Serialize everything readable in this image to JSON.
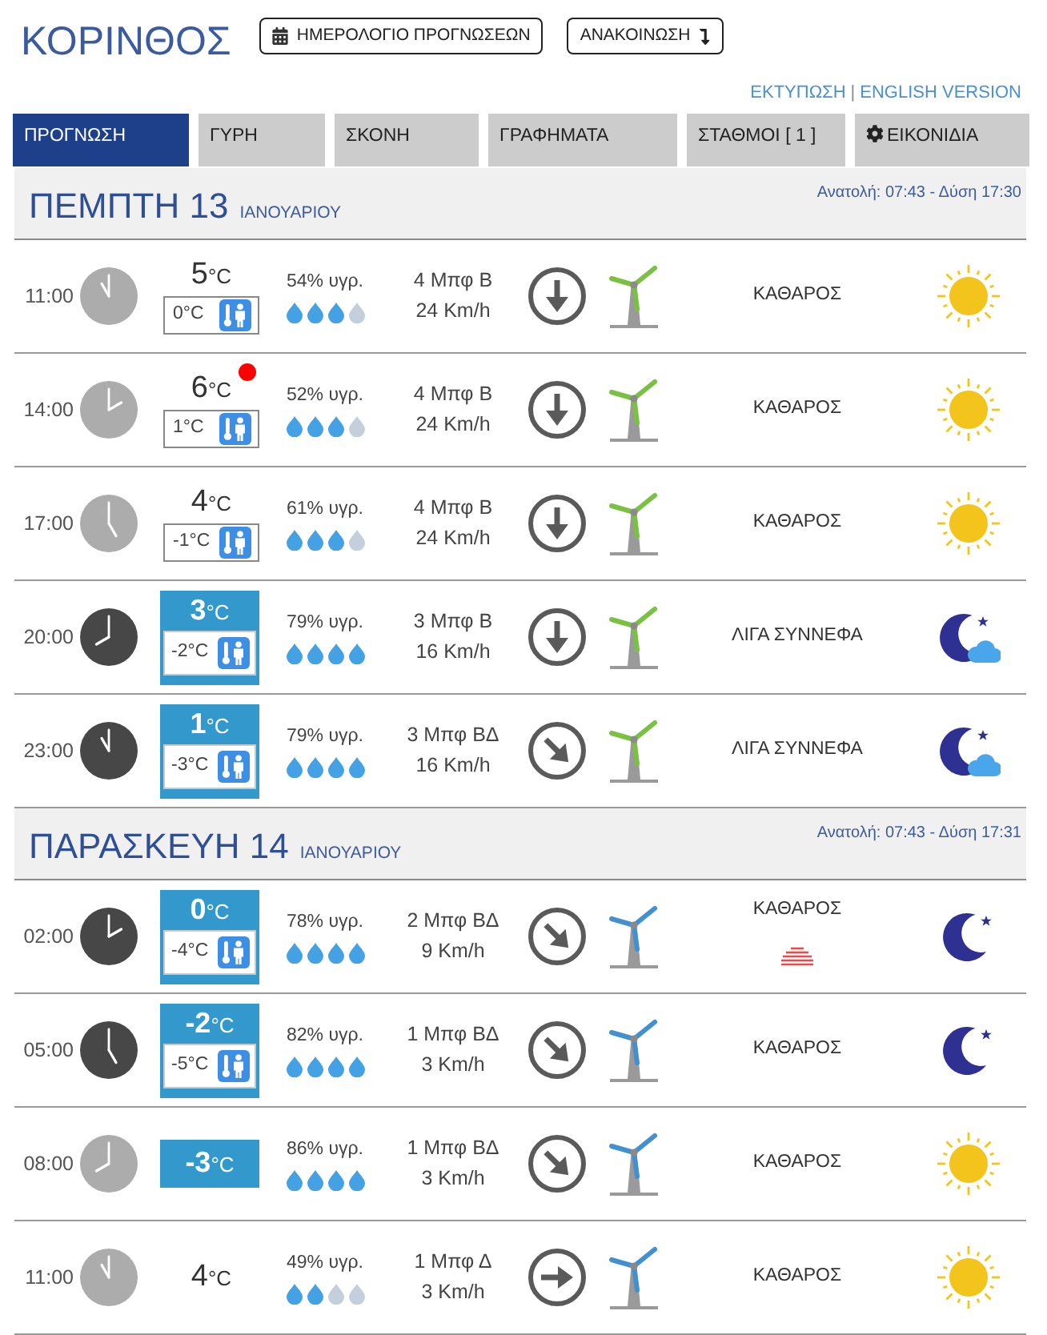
{
  "header": {
    "title": "ΚΟΡΙΝΘΟΣ",
    "buttons": [
      {
        "label": "ΗΜΕΡΟΛΟΓΙΟ ΠΡΟΓΝΩΣΕΩΝ",
        "kind": "calendar"
      },
      {
        "label": "ΑΝΑΚΟΙΝΩΣΗ",
        "kind": "announcement"
      }
    ],
    "links": [
      "ΕΚΤΥΠΩΣΗ",
      "ENGLISH VERSION"
    ],
    "link_separator": "|"
  },
  "tabs": [
    {
      "label": "ΠΡΟΓΝΩΣΗ",
      "selected": true,
      "kind": "plain"
    },
    {
      "label": "ΓΥΡΗ",
      "selected": false,
      "kind": "plain"
    },
    {
      "label": "ΣΚΟΝΗ",
      "selected": false,
      "kind": "plain"
    },
    {
      "label": "ΓΡΑΦΗΜΑΤΑ",
      "selected": false,
      "kind": "plain"
    },
    {
      "label": "ΣΤΑΘΜΟΙ [ 1 ]",
      "selected": false,
      "kind": "plain"
    },
    {
      "label": "ΕΙΚΟΝΙΔΙΑ",
      "selected": false,
      "kind": "settings"
    }
  ],
  "days": [
    {
      "title": "ΠΕΜΠΤΗ 13",
      "month": "ΙΑΝΟΥΑΡΙΟΥ",
      "sun_times": "Ανατολή: 07:43 - Δύση 17:30",
      "rows": [
        {
          "time": "11:00",
          "night": false,
          "temp": {
            "value": "5",
            "unit": "°C",
            "highlighted": false
          },
          "feels_like": "0°C",
          "notice": false,
          "humidity": {
            "label": "54% υγρ.",
            "stars": 3
          },
          "wind": {
            "force": "4 Μπφ Β",
            "speed": "24 Km/h",
            "arrow": {
              "kind": "down"
            }
          },
          "turbine": {
            "color": "#7ac143"
          },
          "condition": "ΚΑΘΑΡΟΣ",
          "haze": false,
          "sky": {
            "kind": "sun"
          }
        },
        {
          "time": "14:00",
          "night": false,
          "temp": {
            "value": "6",
            "unit": "°C",
            "highlighted": false
          },
          "feels_like": "1°C",
          "notice": true,
          "humidity": {
            "label": "52% υγρ.",
            "stars": 3
          },
          "wind": {
            "force": "4 Μπφ Β",
            "speed": "24 Km/h",
            "arrow": {
              "kind": "down"
            }
          },
          "turbine": {
            "color": "#7ac143"
          },
          "condition": "ΚΑΘΑΡΟΣ",
          "haze": false,
          "sky": {
            "kind": "sun"
          }
        },
        {
          "time": "17:00",
          "night": false,
          "temp": {
            "value": "4",
            "unit": "°C",
            "highlighted": false
          },
          "feels_like": "-1°C",
          "notice": false,
          "humidity": {
            "label": "61% υγρ.",
            "stars": 3
          },
          "wind": {
            "force": "4 Μπφ Β",
            "speed": "24 Km/h",
            "arrow": {
              "kind": "down"
            }
          },
          "turbine": {
            "color": "#7ac143"
          },
          "condition": "ΚΑΘΑΡΟΣ",
          "haze": false,
          "sky": {
            "kind": "sun"
          }
        },
        {
          "time": "20:00",
          "night": true,
          "temp": {
            "value": "3",
            "unit": "°C",
            "highlighted": true
          },
          "feels_like": "-2°C",
          "notice": false,
          "humidity": {
            "label": "79% υγρ.",
            "stars": 4
          },
          "wind": {
            "force": "3 Μπφ Β",
            "speed": "16 Km/h",
            "arrow": {
              "kind": "down"
            }
          },
          "turbine": {
            "color": "#7ac143"
          },
          "condition": "ΛΙΓΑ ΣΥΝΝΕΦΑ",
          "haze": false,
          "sky": {
            "kind": "moon-cloud"
          }
        },
        {
          "time": "23:00",
          "night": true,
          "temp": {
            "value": "1",
            "unit": "°C",
            "highlighted": true
          },
          "feels_like": "-3°C",
          "notice": false,
          "humidity": {
            "label": "79% υγρ.",
            "stars": 4
          },
          "wind": {
            "force": "3 Μπφ ΒΔ",
            "speed": "16 Km/h",
            "arrow": {
              "kind": "down-right"
            }
          },
          "turbine": {
            "color": "#7ac143"
          },
          "condition": "ΛΙΓΑ ΣΥΝΝΕΦΑ",
          "haze": false,
          "sky": {
            "kind": "moon-cloud"
          }
        }
      ]
    },
    {
      "title": "ΠΑΡΑΣΚΕΥΗ 14",
      "month": "ΙΑΝΟΥΑΡΙΟΥ",
      "sun_times": "Ανατολή: 07:43 - Δύση 17:31",
      "rows": [
        {
          "time": "02:00",
          "night": true,
          "temp": {
            "value": "0",
            "unit": "°C",
            "highlighted": true
          },
          "feels_like": "-4°C",
          "notice": false,
          "humidity": {
            "label": "78% υγρ.",
            "stars": 4
          },
          "wind": {
            "force": "2 Μπφ ΒΔ",
            "speed": "9 Km/h",
            "arrow": {
              "kind": "down-right"
            }
          },
          "turbine": {
            "color": "#4390d0"
          },
          "condition": "ΚΑΘΑΡΟΣ",
          "haze": true,
          "sky": {
            "kind": "moon"
          }
        },
        {
          "time": "05:00",
          "night": true,
          "temp": {
            "value": "-2",
            "unit": "°C",
            "highlighted": true
          },
          "feels_like": "-5°C",
          "notice": false,
          "humidity": {
            "label": "82% υγρ.",
            "stars": 4
          },
          "wind": {
            "force": "1 Μπφ ΒΔ",
            "speed": "3 Km/h",
            "arrow": {
              "kind": "down-right"
            }
          },
          "turbine": {
            "color": "#4390d0"
          },
          "condition": "ΚΑΘΑΡΟΣ",
          "haze": false,
          "sky": {
            "kind": "moon"
          }
        },
        {
          "time": "08:00",
          "night": false,
          "temp": {
            "value": "-3",
            "unit": "°C",
            "highlighted": true
          },
          "notice": false,
          "humidity": {
            "label": "86% υγρ.",
            "stars": 4
          },
          "wind": {
            "force": "1 Μπφ ΒΔ",
            "speed": "3 Km/h",
            "arrow": {
              "kind": "down-right"
            }
          },
          "turbine": {
            "color": "#4390d0"
          },
          "condition": "ΚΑΘΑΡΟΣ",
          "haze": false,
          "sky": {
            "kind": "sun"
          }
        },
        {
          "time": "11:00",
          "night": false,
          "temp": {
            "value": "4",
            "unit": "°C",
            "highlighted": false
          },
          "notice": false,
          "humidity": {
            "label": "49% υγρ.",
            "stars": 2
          },
          "wind": {
            "force": "1 Μπφ Δ",
            "speed": "3 Km/h",
            "arrow": {
              "kind": "right"
            }
          },
          "turbine": {
            "color": "#4390d0"
          },
          "condition": "ΚΑΘΑΡΟΣ",
          "haze": false,
          "sky": {
            "kind": "sun"
          }
        }
      ]
    }
  ]
}
